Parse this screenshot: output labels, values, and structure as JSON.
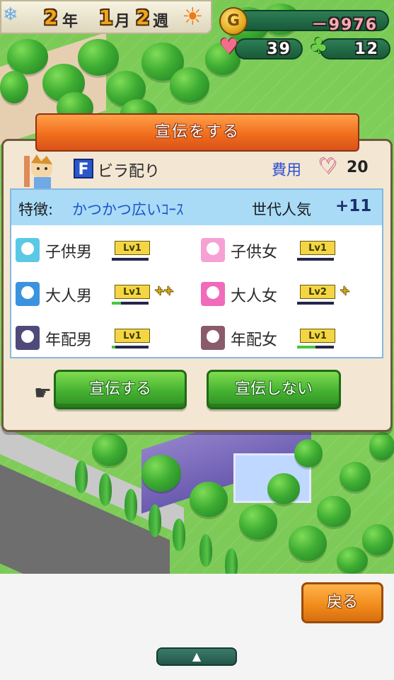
{
  "hud": {
    "year": "2",
    "year_unit": "年",
    "month": "1",
    "month_unit": "月",
    "week": "2",
    "week_unit": "週",
    "money": "－9976",
    "hearts": "39",
    "visitors": "12",
    "coin_letter": "G",
    "icons": [
      "snowflake-icon",
      "sun-icon",
      "coin-icon",
      "heart-icon",
      "tree-icon"
    ]
  },
  "dialog": {
    "title": "宣伝をする",
    "ad_rank": "F",
    "ad_name": "ビラ配り",
    "cost_label": "費用",
    "cost_value": "20",
    "feature_label": "特徴:",
    "feature_value": "かつかつ広いｺｰｽ",
    "popularity_label": "世代人気",
    "popularity_value": "+11",
    "demographics": [
      {
        "label": "子供男",
        "level": "Lv1",
        "bar": 0,
        "plus": "",
        "color": "#5bc9e6"
      },
      {
        "label": "子供女",
        "level": "Lv1",
        "bar": 0,
        "plus": "",
        "color": "#f6a1d4"
      },
      {
        "label": "大人男",
        "level": "Lv1",
        "bar": 0.25,
        "plus": "++",
        "color": "#3b93e0"
      },
      {
        "label": "大人女",
        "level": "Lv2",
        "bar": 0,
        "plus": "+",
        "color": "#f06bbb"
      },
      {
        "label": "年配男",
        "level": "Lv1",
        "bar": 0.1,
        "plus": "",
        "color": "#4e4a7a"
      },
      {
        "label": "年配女",
        "level": "Lv1",
        "bar": 0.5,
        "plus": "",
        "color": "#8a5b6b"
      }
    ],
    "confirm_label": "宣伝する",
    "cancel_label": "宣伝しない"
  },
  "bottom": {
    "back_label": "戻る",
    "expand_label": "▲"
  },
  "colors": {
    "ribbon": "#f06e1d",
    "panel": "#f3e7d3",
    "button_green": "#45b132",
    "button_orange": "#f08a1a",
    "feature_blue": "#1d56c8"
  }
}
